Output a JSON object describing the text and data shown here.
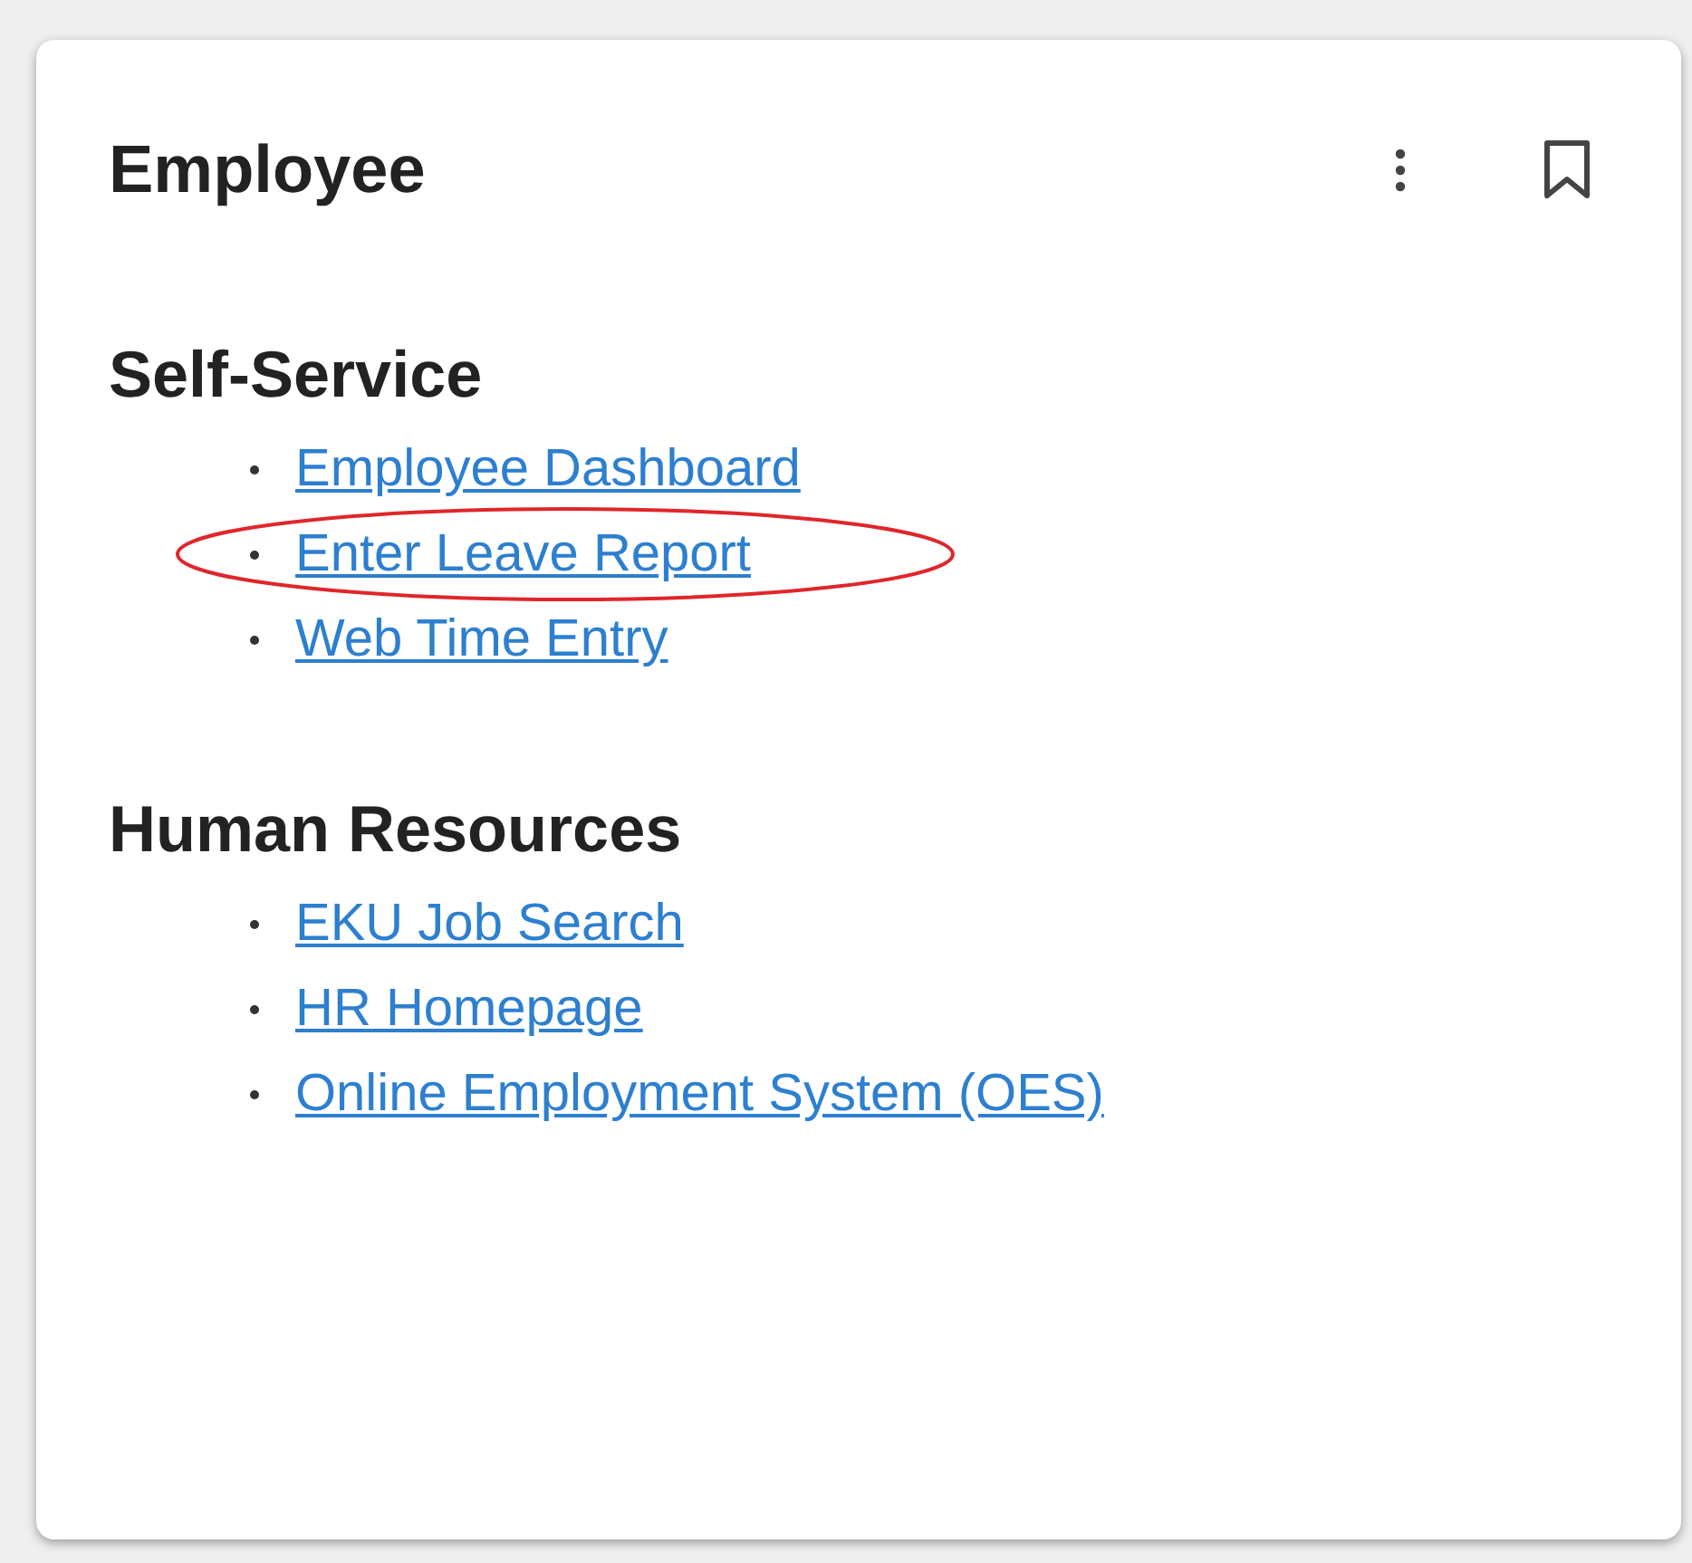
{
  "card": {
    "title": "Employee",
    "sections": [
      {
        "heading": "Self-Service",
        "links": [
          {
            "label": "Employee Dashboard",
            "highlighted": false
          },
          {
            "label": "Enter Leave Report",
            "highlighted": true
          },
          {
            "label": "Web Time Entry",
            "highlighted": false
          }
        ]
      },
      {
        "heading": "Human Resources",
        "links": [
          {
            "label": "EKU Job Search",
            "highlighted": false
          },
          {
            "label": "HR Homepage",
            "highlighted": false
          },
          {
            "label": "Online Employment System (OES)",
            "highlighted": false
          }
        ]
      }
    ]
  }
}
